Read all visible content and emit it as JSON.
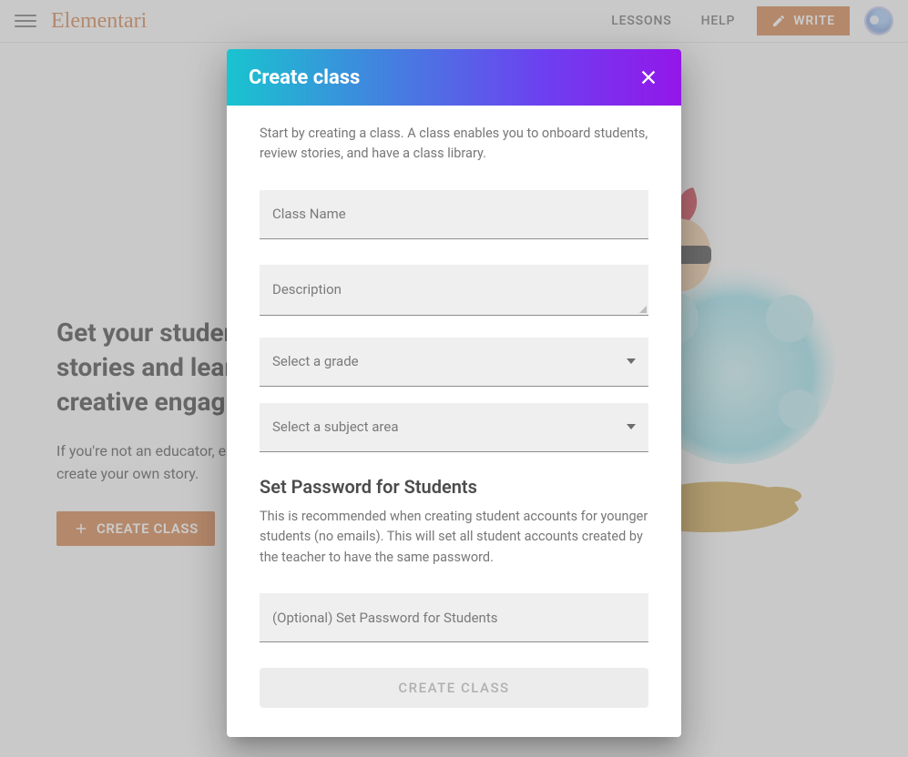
{
  "header": {
    "brand": "Elementari",
    "nav": {
      "lessons": "LESSONS",
      "help": "HELP"
    },
    "write_button": "WRITE"
  },
  "hero": {
    "headline": "Get your students to write interactive stories and learn how to code through a creative engaging environment.",
    "sub": "If you're not an educator, explore and remix community stories or create your own story.",
    "create_class_button": "CREATE CLASS"
  },
  "modal": {
    "title": "Create class",
    "intro": "Start by creating a class. A class enables you to onboard students, review stories, and have a class library.",
    "fields": {
      "class_name_label": "Class Name",
      "description_label": "Description",
      "grade_select_label": "Select a grade",
      "subject_select_label": "Select a subject area",
      "password_label": "(Optional) Set Password for Students"
    },
    "password_section": {
      "title": "Set Password for Students",
      "desc": "This is recommended when creating student accounts for younger students (no emails). This will set all student accounts created by the teacher to have the same password."
    },
    "submit_label": "CREATE CLASS"
  }
}
